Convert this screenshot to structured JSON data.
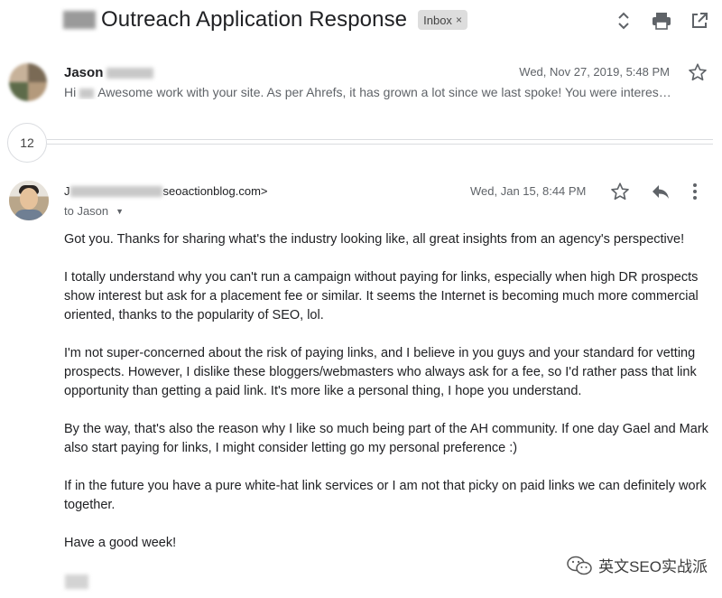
{
  "thread": {
    "subject": "Outreach Application Response",
    "label": "Inbox",
    "label_remove": "×"
  },
  "toolbar": {
    "icons": [
      "expand-collapse-icon",
      "print-icon",
      "open-in-new-window-icon"
    ]
  },
  "message1": {
    "sender_name": "Jason",
    "date": "Wed, Nov 27, 2019, 5:48 PM",
    "snippet_before": "Hi",
    "snippet_after": "Awesome work with your site. As per Ahrefs, it has grown a lot since we last spoke! You were interes…"
  },
  "collapsed": {
    "count": "12"
  },
  "message2": {
    "sender_visible": "J",
    "sender_domain": "seoactionblog.com>",
    "date": "Wed, Jan 15, 8:44 PM",
    "to": "to Jason",
    "body": [
      "Got you. Thanks for sharing what's the industry looking like, all great insights from an agency's perspective!",
      "I totally understand why you can't run a campaign without paying for links, especially when high DR prospects show interest but ask for a placement fee or similar. It seems the Internet is becoming much more commercial oriented, thanks to the popularity of SEO, lol.",
      "I'm not super-concerned about the risk of paying links, and I believe in you guys and your standard for vetting prospects. However, I dislike these bloggers/webmasters who always ask for a fee, so I'd rather pass that link opportunity than getting a paid link. It's more like a personal thing, I hope you understand.",
      "By the way, that's also the reason why I like so much being part of the AH community. If one day Gael and Mark also start paying for links, I might consider letting go my personal preference :)",
      "If in the future you have a pure white-hat link services or I am not that picky on paid links we can definitely work together.",
      "Have a good week!"
    ]
  },
  "watermark": {
    "text": "英文SEO实战派"
  },
  "colors": {
    "text": "#202124",
    "secondary": "#5f6368",
    "chip_bg": "#dddddd",
    "divider": "#dadce0"
  }
}
